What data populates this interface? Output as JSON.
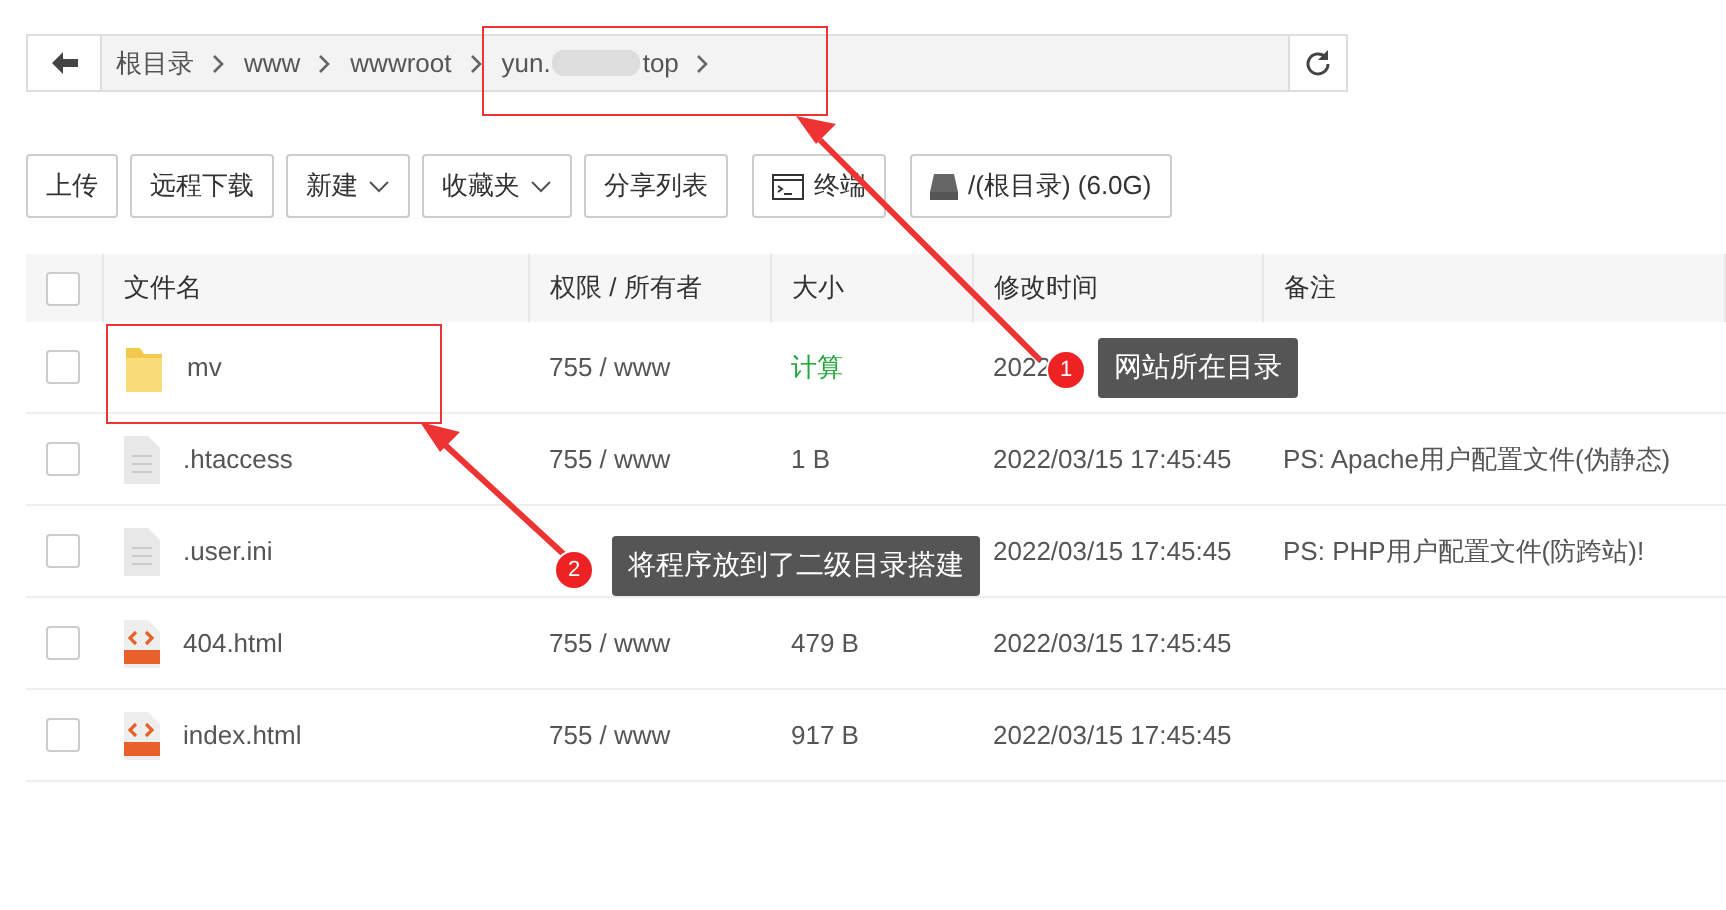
{
  "path_bar": {
    "crumbs": [
      {
        "parts": [
          "根目录"
        ]
      },
      {
        "parts": [
          "www"
        ]
      },
      {
        "parts": [
          "wwwroot"
        ]
      },
      {
        "parts": [
          "yun.",
          "top"
        ],
        "redacted": true
      }
    ]
  },
  "toolbar": [
    {
      "label": "上传",
      "kind": "plain"
    },
    {
      "label": "远程下载",
      "kind": "plain"
    },
    {
      "label": "新建",
      "kind": "dropdown"
    },
    {
      "label": "收藏夹",
      "kind": "dropdown"
    },
    {
      "label": "分享列表",
      "kind": "plain"
    },
    {
      "label": "终端",
      "kind": "terminal"
    },
    {
      "label": "/(根目录) (6.0G)",
      "kind": "disk"
    }
  ],
  "table": {
    "select_all_checked": false,
    "columns": [
      "文件名",
      "权限 / 所有者",
      "大小",
      "修改时间",
      "备注"
    ],
    "rows": [
      {
        "kind": "folder",
        "name": "mv",
        "perms": "755 / www",
        "size": "计算",
        "size_link": true,
        "time": "2022",
        "checked": false
      },
      {
        "kind": "file",
        "name": ".htaccess",
        "perms": "755 / www",
        "size": "1 B",
        "size_link": false,
        "time": "2022/03/15 17:45:45",
        "note": "PS: Apache用户配置文件(伪静态)",
        "checked": false
      },
      {
        "kind": "file",
        "name": ".user.ini",
        "time": "2022/03/15 17:45:45",
        "note": "PS: PHP用户配置文件(防跨站)!",
        "checked": false
      },
      {
        "kind": "html",
        "name": "404.html",
        "perms": "755 / www",
        "size": "479 B",
        "size_link": false,
        "time": "2022/03/15 17:45:45",
        "checked": false
      },
      {
        "kind": "html",
        "name": "index.html",
        "perms": "755 / www",
        "size": "917 B",
        "size_link": false,
        "time": "2022/03/15 17:45:45",
        "checked": false
      }
    ]
  },
  "annotations": [
    {
      "number": "1",
      "text": "网站所在目录"
    },
    {
      "number": "2",
      "text": "将程序放到了二级目录搭建"
    }
  ]
}
